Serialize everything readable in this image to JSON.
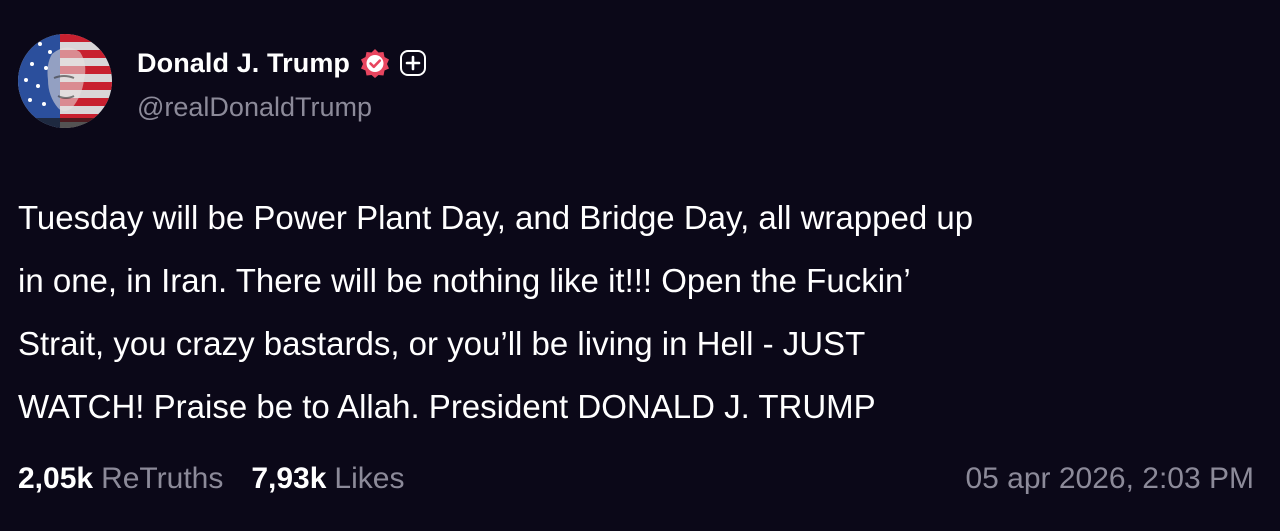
{
  "author": {
    "display_name": "Donald J. Trump",
    "handle": "@realDonaldTrump",
    "avatar_icon": "avatar-flag-portrait",
    "verified_icon": "verified-badge-icon",
    "verified_color": "#e8455f",
    "follow_icon": "plus-icon"
  },
  "post": {
    "text_lines": [
      "Tuesday will be Power Plant Day, and Bridge Day, all wrapped up",
      "in one, in Iran. There will be nothing like it!!! Open the Fuckin’",
      "Strait, you crazy bastards, or you’ll be living in Hell - JUST",
      "WATCH! Praise be to Allah. President DONALD J. TRUMP"
    ]
  },
  "stats": {
    "retruths_count": "2,05k",
    "retruths_label": "ReTruths",
    "likes_count": "7,93k",
    "likes_label": "Likes"
  },
  "timestamp": "05 apr 2026, 2:03 PM",
  "colors": {
    "background": "#0b0818",
    "text": "#ffffff",
    "muted": "#8c8a99"
  }
}
